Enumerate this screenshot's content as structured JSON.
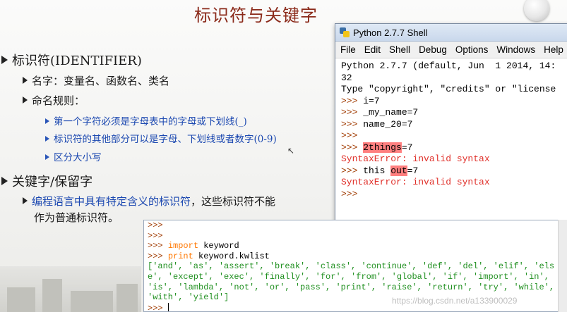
{
  "slide": {
    "title": "标识符与关键字",
    "bullets": {
      "identifier_heading": "标识符(IDENTIFIER)",
      "name_line": "名字：变量名、函数名、类名",
      "rules_heading": "命名规则：",
      "rule1": "第一个字符必须是字母表中的字母或下划线(_)",
      "rule2": "标识符的其他部分可以是字母、下划线或者数字(0-9)",
      "rule3": "区分大小写",
      "keyword_heading": "关键字/保留字",
      "keyword_desc_a": "编程语言中具有特定含义的标识符",
      "keyword_desc_b": "，这些标识符不能",
      "keyword_desc_c": "作为普通标识符。"
    }
  },
  "shell_window": {
    "title": "Python 2.7.7 Shell",
    "menu": [
      "File",
      "Edit",
      "Shell",
      "Debug",
      "Options",
      "Windows",
      "Help"
    ],
    "lines": {
      "banner1": "Python 2.7.7 (default, Jun  1 2014, 14:",
      "banner2": "32",
      "banner3": "Type \"copyright\", \"credits\" or \"license",
      "prompt": ">>> ",
      "cmd1": "i=7",
      "cmd2": "_my_name=7",
      "cmd3": "name_20=7",
      "cmd4_bad": "2things",
      "cmd4_rest": "=7",
      "error": "SyntaxError: invalid syntax",
      "cmd5_a": "this ",
      "cmd5_bad": "out",
      "cmd5_rest": "=7"
    }
  },
  "console": {
    "prompt": ">>> ",
    "import_kw": "import",
    "import_mod": " keyword",
    "print_kw": "print",
    "print_expr": " keyword.kwlist",
    "kwlist_lines": [
      "['and', 'as', 'assert', 'break', 'class', 'continue', 'def', 'del', 'elif', 'els",
      "e', 'except', 'exec', 'finally', 'for', 'from', 'global', 'if', 'import', 'in',",
      "'is', 'lambda', 'not', 'or', 'pass', 'print', 'raise', 'return', 'try', 'while',",
      "'with', 'yield']"
    ]
  },
  "watermark": "https://blog.csdn.net/a133900029",
  "colors": {
    "title": "#8b2a1a",
    "rule_text": "#1a47b0",
    "shell_prompt": "#a03a00",
    "error": "#e0302a",
    "error_highlight": "#ff7f7f",
    "keyword": "#ff7700",
    "string": "#1f8f1f"
  }
}
